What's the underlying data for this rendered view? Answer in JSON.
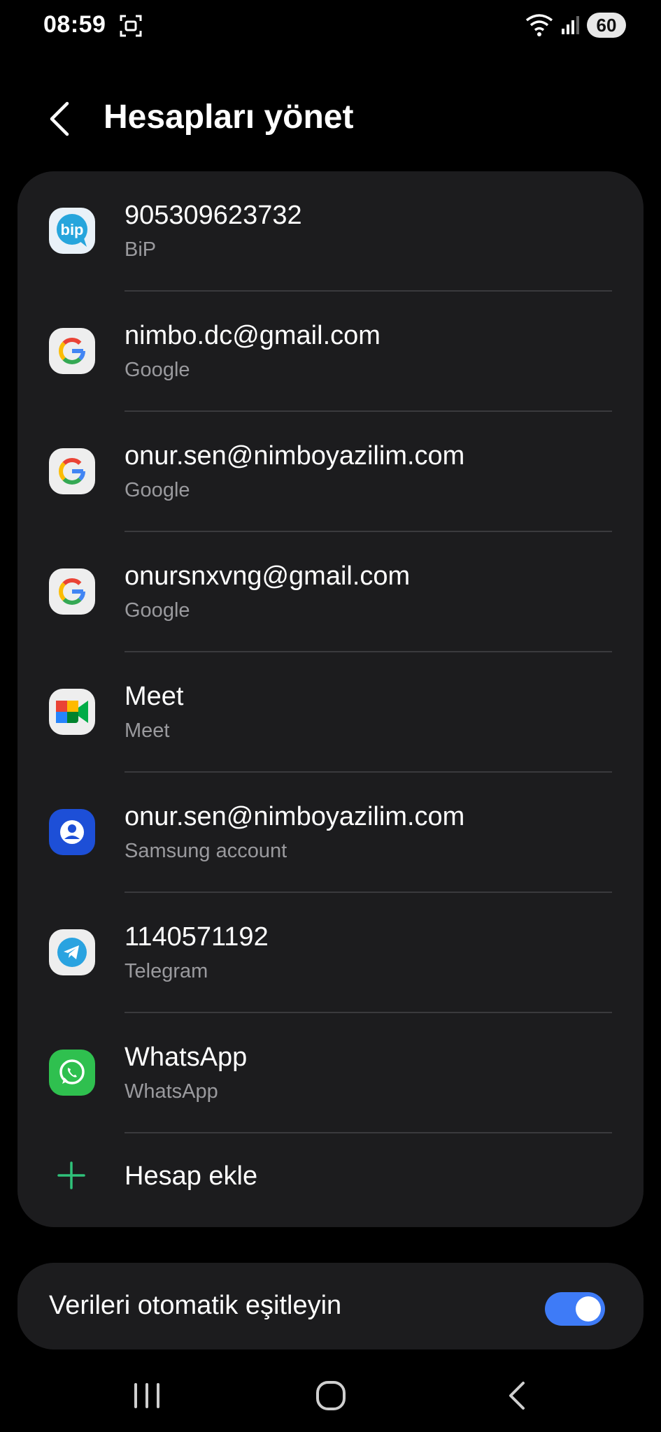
{
  "status_bar": {
    "time": "08:59",
    "battery": "60"
  },
  "header": {
    "title": "Hesapları yönet"
  },
  "accounts": [
    {
      "primary": "905309623732",
      "secondary": "BiP",
      "icon": "bip-icon"
    },
    {
      "primary": "nimbo.dc@gmail.com",
      "secondary": "Google",
      "icon": "google-icon"
    },
    {
      "primary": "onur.sen@nimboyazilim.com",
      "secondary": "Google",
      "icon": "google-icon"
    },
    {
      "primary": "onursnxvng@gmail.com",
      "secondary": "Google",
      "icon": "google-icon"
    },
    {
      "primary": "Meet",
      "secondary": "Meet",
      "icon": "meet-icon"
    },
    {
      "primary": "onur.sen@nimboyazilim.com",
      "secondary": "Samsung account",
      "icon": "samsung-account-icon"
    },
    {
      "primary": "1140571192",
      "secondary": "Telegram",
      "icon": "telegram-icon"
    },
    {
      "primary": "WhatsApp",
      "secondary": "WhatsApp",
      "icon": "whatsapp-icon"
    }
  ],
  "add_account": {
    "label": "Hesap ekle"
  },
  "sync": {
    "label": "Verileri otomatik eşitleyin",
    "enabled": true
  },
  "colors": {
    "accent": "#3e7bf7",
    "add_plus": "#2fc27a",
    "card": "#1c1c1e"
  }
}
